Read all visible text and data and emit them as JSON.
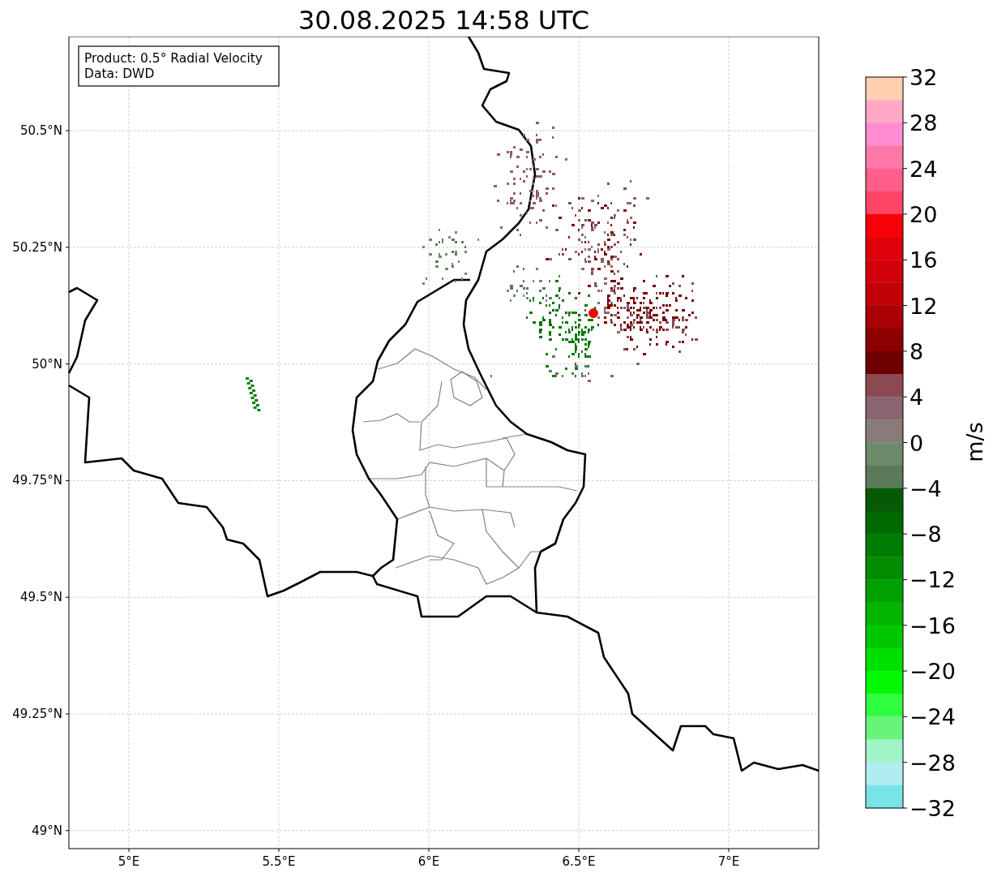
{
  "title": "30.08.2025 14:58 UTC",
  "info_box": {
    "lines": [
      "Product: 0.5° Radial Velocity",
      "Data: DWD"
    ]
  },
  "map": {
    "lat_ticks": [
      "50.5°N",
      "50.25°N",
      "50°N",
      "49.75°N",
      "49.5°N",
      "49.25°N",
      "49°N"
    ],
    "lon_ticks": [
      "5°E",
      "5.5°E",
      "6°E",
      "6.5°E",
      "7°E"
    ]
  },
  "colorbar": {
    "label": "m/s",
    "ticks": [
      "32",
      "28",
      "24",
      "20",
      "16",
      "12",
      "8",
      "4",
      "0",
      "−4",
      "−8",
      "−12",
      "−16",
      "−20",
      "−24",
      "−28",
      "−32"
    ],
    "segments": [
      {
        "color": "#ffcfb0"
      },
      {
        "color": "#ffa8c4"
      },
      {
        "color": "#ff8bd0"
      },
      {
        "color": "#ff77a8"
      },
      {
        "color": "#ff5f8a"
      },
      {
        "color": "#ff4466"
      },
      {
        "color": "#f70008"
      },
      {
        "color": "#e0000a"
      },
      {
        "color": "#d0000a"
      },
      {
        "color": "#c00006"
      },
      {
        "color": "#a80004"
      },
      {
        "color": "#8c0000"
      },
      {
        "color": "#6e0000"
      },
      {
        "color": "#8a4a52"
      },
      {
        "color": "#8a6470"
      },
      {
        "color": "#8a7a78"
      },
      {
        "color": "#6e8a6c"
      },
      {
        "color": "#5a7a5a"
      },
      {
        "color": "#065a06"
      },
      {
        "color": "#006a00"
      },
      {
        "color": "#007c00"
      },
      {
        "color": "#008e00"
      },
      {
        "color": "#00a000"
      },
      {
        "color": "#00b400"
      },
      {
        "color": "#00c800"
      },
      {
        "color": "#00e000"
      },
      {
        "color": "#00f800"
      },
      {
        "color": "#30ff40"
      },
      {
        "color": "#66f57a"
      },
      {
        "color": "#9ff5c8"
      },
      {
        "color": "#b0ecf0"
      },
      {
        "color": "#78e4e8"
      }
    ]
  }
}
